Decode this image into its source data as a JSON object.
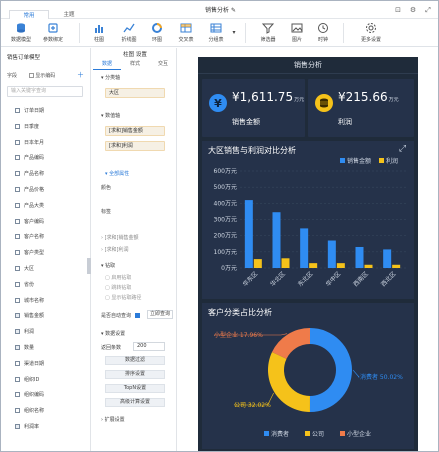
{
  "tabs": [
    {
      "label": "常用"
    },
    {
      "label": "主题"
    }
  ],
  "doc_title": "销售分析",
  "toolbar": {
    "items": [
      {
        "label": "数据模型"
      },
      {
        "label": "参数绑定"
      },
      {
        "label": "柱图"
      },
      {
        "label": "折线图"
      },
      {
        "label": "环图"
      },
      {
        "label": "交叉表"
      },
      {
        "label": "分组表"
      },
      {
        "label": "筛选器"
      },
      {
        "label": "图片"
      },
      {
        "label": "时钟"
      },
      {
        "label": "更多设置"
      }
    ]
  },
  "left_panel": {
    "title": "销售订单模型",
    "field_label": "字段",
    "show_code_label": "显示编码",
    "search_placeholder": "输入关键字查询",
    "fields": [
      "订单日期",
      "日季度",
      "日本年月",
      "产品编码",
      "产品名称",
      "产品价格",
      "产品大类",
      "客户编码",
      "客户名称",
      "客户类型",
      "大区",
      "省份",
      "城市名称",
      "销售金额",
      "利润",
      "数量",
      "渠道日期",
      "组织ID",
      "组织编码",
      "组织名称",
      "利润率"
    ]
  },
  "middle_panel": {
    "title": "柱图 设置",
    "tabs": [
      "数据",
      "样式",
      "交互"
    ],
    "sections": {
      "category": "分类轴",
      "category_value": "大区",
      "value_axis": "数值轴",
      "value1": "[求和]销售金额",
      "value2": "[求和]利润",
      "global_prop": "全部属性",
      "color": "颜色",
      "label": "标签",
      "agg1": "[求和]销售金额",
      "agg2": "[求和]利润",
      "drill": "钻取",
      "opt1": "启用钻取",
      "opt2": "跳转钻取",
      "opt3": "显示钻取路径",
      "auto_refresh": "是否自动查询",
      "refresh_button": "立即查询",
      "data_settings": "数据设置",
      "row_count_label": "返回条数",
      "row_count": "200",
      "btn_filter": "数据过滤",
      "btn_sort": "排序设置",
      "btn_topn": "TopN设置",
      "btn_calc": "高级计算设置",
      "extend": "扩展设置"
    }
  },
  "dashboard": {
    "title": "销售分析",
    "kpis": [
      {
        "value": "¥1,611.75",
        "unit": "万元",
        "label": "销售金额"
      },
      {
        "value": "¥215.66",
        "unit": "万元",
        "label": "利润"
      }
    ],
    "colors": {
      "accent_blue": "#2f8cf2",
      "accent_yellow": "#f5c21a",
      "accent_orange": "#ef7b4a",
      "panel_bg": "#25324a"
    },
    "icons": [
      "yen-icon",
      "coins-icon",
      "expand-icon"
    ]
  },
  "chart_data": [
    {
      "type": "bar",
      "title": "大区销售与利润对比分析",
      "categories": [
        "华东区",
        "华北区",
        "东北区",
        "华中区",
        "西南区",
        "西北区"
      ],
      "series": [
        {
          "name": "销售金额",
          "values": [
            420,
            345,
            245,
            170,
            130,
            115
          ],
          "color": "#2f8cf2"
        },
        {
          "name": "利润",
          "values": [
            55,
            60,
            30,
            30,
            20,
            20
          ],
          "color": "#f5c21a"
        }
      ],
      "ytick_labels": [
        "0万元",
        "100万元",
        "200万元",
        "300万元",
        "400万元",
        "500万元",
        "600万元"
      ],
      "ylim": [
        0,
        600
      ],
      "legend": "top-right"
    },
    {
      "type": "pie",
      "title": "客户分类占比分析",
      "slices": [
        {
          "name": "消费者",
          "value": 50.02,
          "label": "消费者 50.02%",
          "color": "#2f8cf2"
        },
        {
          "name": "公司",
          "value": 32.02,
          "label": "公司 32.02%",
          "color": "#f5c21a"
        },
        {
          "name": "小型企业",
          "value": 17.96,
          "label": "小型企业 17.96%",
          "color": "#ef7b4a"
        }
      ],
      "legend": "bottom"
    }
  ]
}
